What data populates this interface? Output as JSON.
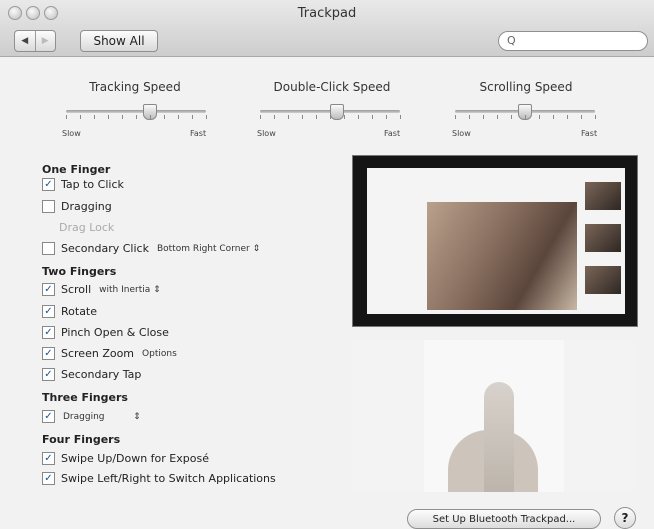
{
  "window": {
    "title": "Trackpad"
  },
  "toolbar": {
    "back": "◀",
    "forward": "▶",
    "show_all": "Show All",
    "search_icon": "search-icon"
  },
  "sliders": [
    {
      "label": "Tracking Speed",
      "min": "Slow",
      "max": "Fast",
      "value": 0.6
    },
    {
      "label": "Double-Click Speed",
      "min": "Slow",
      "max": "Fast",
      "value": 0.55
    },
    {
      "label": "Scrolling Speed",
      "min": "Slow",
      "max": "Fast",
      "value": 0.5
    }
  ],
  "one_finger": {
    "header": "One Finger",
    "tap_to_click": "Tap to Click",
    "dragging": "Dragging",
    "drag_lock": "Drag Lock",
    "secondary_click": "Secondary Click",
    "secondary_click_option": "Bottom Right Corner"
  },
  "two_fingers": {
    "header": "Two Fingers",
    "scroll": "Scroll",
    "scroll_option": "with Inertia",
    "rotate": "Rotate",
    "pinch": "Pinch Open & Close",
    "screen_zoom": "Screen Zoom",
    "screen_zoom_option": "Options",
    "secondary_tap": "Secondary Tap"
  },
  "three_fingers": {
    "header": "Three Fingers",
    "dragging": "Dragging"
  },
  "four_fingers": {
    "header": "Four Fingers",
    "expose": "Swipe Up/Down for Exposé",
    "switch_apps": "Swipe Left/Right to Switch Applications"
  },
  "buttons": {
    "bluetooth": "Set Up Bluetooth Trackpad...",
    "help": "?"
  }
}
